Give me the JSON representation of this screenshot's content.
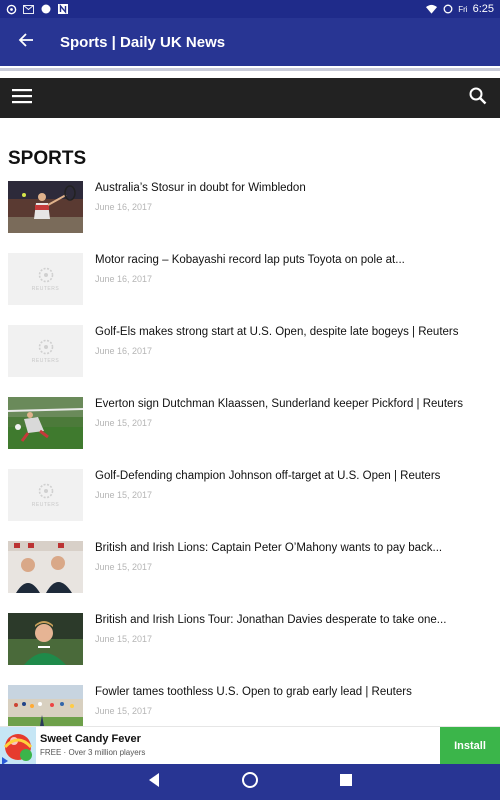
{
  "status_bar": {
    "day": "Fri",
    "time": "6:25",
    "left_icons": [
      "settings-icon",
      "gmail-icon",
      "circle-icon",
      "n-icon"
    ],
    "right_icons": [
      "wifi-icon",
      "sync-icon"
    ]
  },
  "app_bar": {
    "title": "Sports | Daily UK News",
    "back_icon": "arrow-back-icon",
    "color": "#283593"
  },
  "site_nav": {
    "menu_icon": "hamburger-menu-icon",
    "search_icon": "search-icon",
    "background": "#222222"
  },
  "section": {
    "title": "SPORTS"
  },
  "articles": [
    {
      "headline": "Australia’s Stosur in doubt for Wimbledon",
      "date": "June 16, 2017",
      "thumb": "tennis-photo"
    },
    {
      "headline": "Motor racing – Kobayashi record lap puts Toyota on pole at...",
      "date": "June 16, 2017",
      "thumb": "reuters-placeholder"
    },
    {
      "headline": "Golf-Els makes strong start at U.S. Open, despite late bogeys | Reuters",
      "date": "June 16, 2017",
      "thumb": "reuters-placeholder"
    },
    {
      "headline": "Everton sign Dutchman Klaassen, Sunderland keeper Pickford | Reuters",
      "date": "June 15, 2017",
      "thumb": "goalkeeper-photo"
    },
    {
      "headline": "Golf-Defending champion Johnson off-target at U.S. Open | Reuters",
      "date": "June 15, 2017",
      "thumb": "reuters-placeholder"
    },
    {
      "headline": "British and Irish Lions: Captain Peter O’Mahony wants to pay back...",
      "date": "June 15, 2017",
      "thumb": "press-conference-photo"
    },
    {
      "headline": "British and Irish Lions Tour: Jonathan Davies desperate to take one...",
      "date": "June 15, 2017",
      "thumb": "rugby-player-photo"
    },
    {
      "headline": "Fowler tames toothless U.S. Open to grab early lead | Reuters",
      "date": "June 15, 2017",
      "thumb": "golf-crowd-photo"
    }
  ],
  "placeholder_text": "REUTERS",
  "ad": {
    "title": "Sweet Candy Fever",
    "subtitle": "FREE · Over 3 million players",
    "button": "Install",
    "button_color": "#3bb54a"
  },
  "nav_bar": {
    "icons": [
      "back-triangle-icon",
      "home-circle-icon",
      "recents-square-icon"
    ]
  }
}
